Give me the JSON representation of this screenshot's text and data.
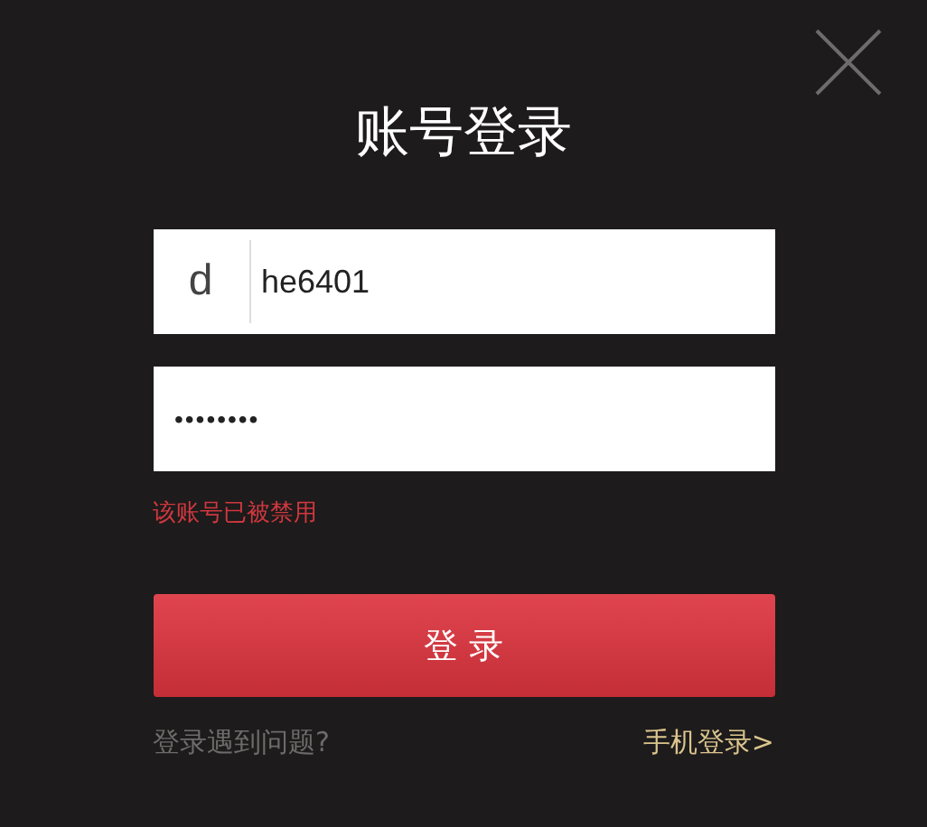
{
  "dialog": {
    "title": "账号登录"
  },
  "username": {
    "prefix": "d",
    "value": "he6401"
  },
  "password": {
    "value": "••••••••"
  },
  "error": "该账号已被禁用",
  "login_button": "登 录",
  "links": [
    {
      "kind": "help",
      "label": "登录遇到问题?"
    },
    {
      "kind": "switch",
      "label": "手机登录>"
    }
  ]
}
